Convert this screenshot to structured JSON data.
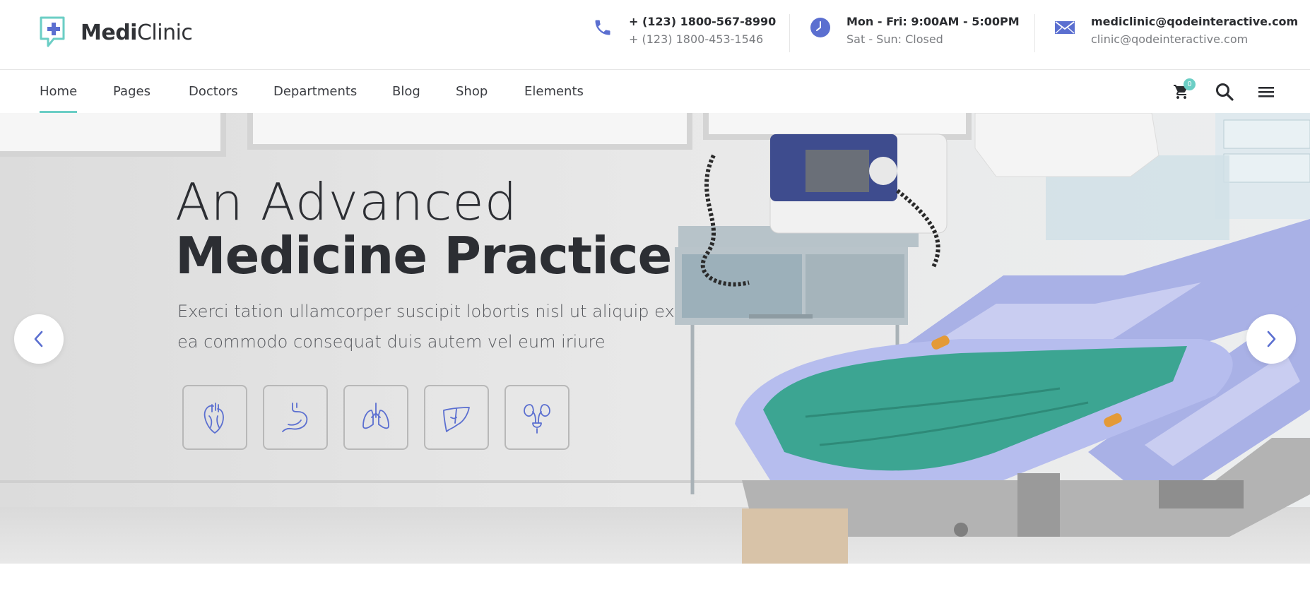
{
  "brand": {
    "name_bold": "Medi",
    "name_light": "Clinic",
    "accent": "#6bcec5",
    "icon_color": "#5b6fd0"
  },
  "contacts": [
    {
      "icon": "phone-icon",
      "line1": "+ (123) 1800-567-8990",
      "line2": "+ (123) 1800-453-1546"
    },
    {
      "icon": "clock-icon",
      "line1": "Mon - Fri: 9:00AM - 5:00PM",
      "line2": "Sat - Sun: Closed"
    },
    {
      "icon": "envelope-icon",
      "line1": "mediclinic@qodeinteractive.com",
      "line2": "clinic@qodeinteractive.com"
    }
  ],
  "nav": {
    "items": [
      "Home",
      "Pages",
      "Doctors",
      "Departments",
      "Blog",
      "Shop",
      "Elements"
    ],
    "active": "Home",
    "cart_count": "0"
  },
  "hero": {
    "title_line1": "An Advanced",
    "title_line2": "Medicine Practice",
    "text": "Exerci tation ullamcorper suscipit lobortis nisl ut aliquip ex ea commodo consequat duis autem vel eum iriure",
    "organ_icons": [
      "heart-icon",
      "stomach-icon",
      "lungs-icon",
      "liver-icon",
      "kidneys-icon"
    ]
  }
}
